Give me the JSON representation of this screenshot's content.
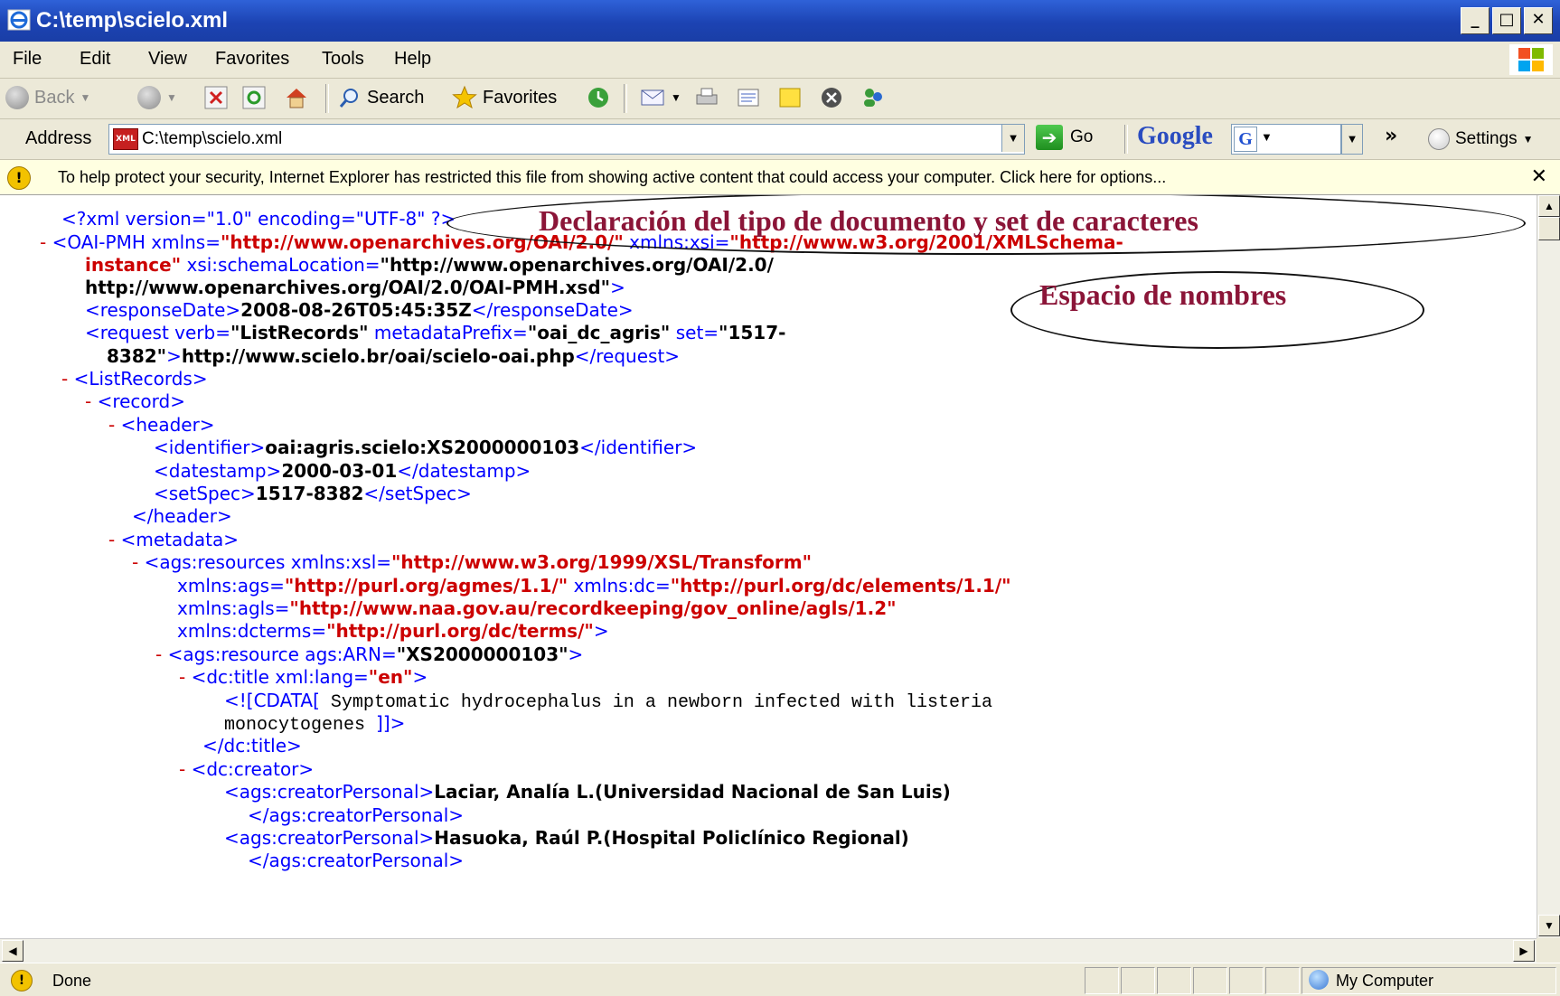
{
  "window": {
    "title": "C:\\temp\\scielo.xml"
  },
  "menu": [
    "File",
    "Edit",
    "View",
    "Favorites",
    "Tools",
    "Help"
  ],
  "toolbar": {
    "back": "Back",
    "search": "Search",
    "favorites": "Favorites"
  },
  "address": {
    "label": "Address",
    "value": "C:\\temp\\scielo.xml",
    "go": "Go"
  },
  "google": {
    "brand": "Google",
    "settings": "Settings"
  },
  "infobar": {
    "message": "To help protect your security, Internet Explorer has restricted this file from showing active content that could access your computer. Click here for options..."
  },
  "status": {
    "left": "Done",
    "zone": "My Computer"
  },
  "annotations": {
    "declaration": "Declaración del tipo de documento y set de caracteres",
    "namespace": "Espacio de nombres"
  },
  "xml": {
    "decl": "<?xml version=\"1.0\" encoding=\"UTF-8\" ?>",
    "oai_open": "<OAI-PMH",
    "xmlns_attr": " xmlns=",
    "xmlns_val": "\"http://www.openarchives.org/OAI/2.0/\"",
    "xsi_attr": " xmlns:xsi=",
    "xsi_val_a": "\"http://www.w3.org/2001/XMLSchema-",
    "xsi_val_b": "instance\"",
    "schema_attr": " xsi:schemaLocation=",
    "schema_val_a": "\"http://www.openarchives.org/OAI/2.0/",
    "schema_val_b": "http://www.openarchives.org/OAI/2.0/OAI-PMH.xsd\"",
    "gt": ">",
    "rd_open": "<responseDate>",
    "rd_val": "2008-08-26T05:45:35Z",
    "rd_close": "</responseDate>",
    "req_open": "<request verb=",
    "req_verb": "\"ListRecords\"",
    "req_mp_attr": " metadataPrefix=",
    "req_mp_val": "\"oai_dc_agris\"",
    "req_set_attr": " set=",
    "req_set_a": "\"1517-",
    "req_set_b": "8382\"",
    "req_url": "http://www.scielo.br/oai/scielo-oai.php",
    "req_close": "</request>",
    "lr_open": "<ListRecords>",
    "record_open": "<record>",
    "header_open": "<header>",
    "id_open": "<identifier>",
    "id_val": "oai:agris.scielo:XS2000000103",
    "id_close": "</identifier>",
    "ds_open": "<datestamp>",
    "ds_val": "2000-03-01",
    "ds_close": "</datestamp>",
    "ss_open": "<setSpec>",
    "ss_val": "1517-8382",
    "ss_close": "</setSpec>",
    "header_close": "</header>",
    "metadata_open": "<metadata>",
    "res_open": "<ags:resources xmlns:xsl=",
    "res_xsl": "\"http://www.w3.org/1999/XSL/Transform\"",
    "res_ags_attr": "xmlns:ags=",
    "res_ags": "\"http://purl.org/agmes/1.1/\"",
    "res_dc_attr": " xmlns:dc=",
    "res_dc": "\"http://purl.org/dc/elements/1.1/\"",
    "res_agls_attr": "xmlns:agls=",
    "res_agls": "\"http://www.naa.gov.au/recordkeeping/gov_online/agls/1.2\"",
    "res_dcterms_attr": "xmlns:dcterms=",
    "res_dcterms": "\"http://purl.org/dc/terms/\"",
    "resource_open": "<ags:resource ags:ARN=",
    "resource_arn": "\"XS2000000103\"",
    "title_open": "<dc:title xml:lang=",
    "title_lang": "\"en\"",
    "cdata_open": "<![CDATA[",
    "cdata_a": " Symptomatic hydrocephalus in a newborn infected with listeria",
    "cdata_b": "monocytogenes  ",
    "cdata_close": "]]>",
    "title_close": "</dc:title>",
    "creator_open": "<dc:creator>",
    "cp_open": "<ags:creatorPersonal>",
    "cp1": "Laciar, Analía L.(Universidad Nacional de San Luis)",
    "cp_close": "</ags:creatorPersonal>",
    "cp2": "Hasuoka, Raúl P.(Hospital Policlínico Regional)",
    "dash": "-"
  }
}
